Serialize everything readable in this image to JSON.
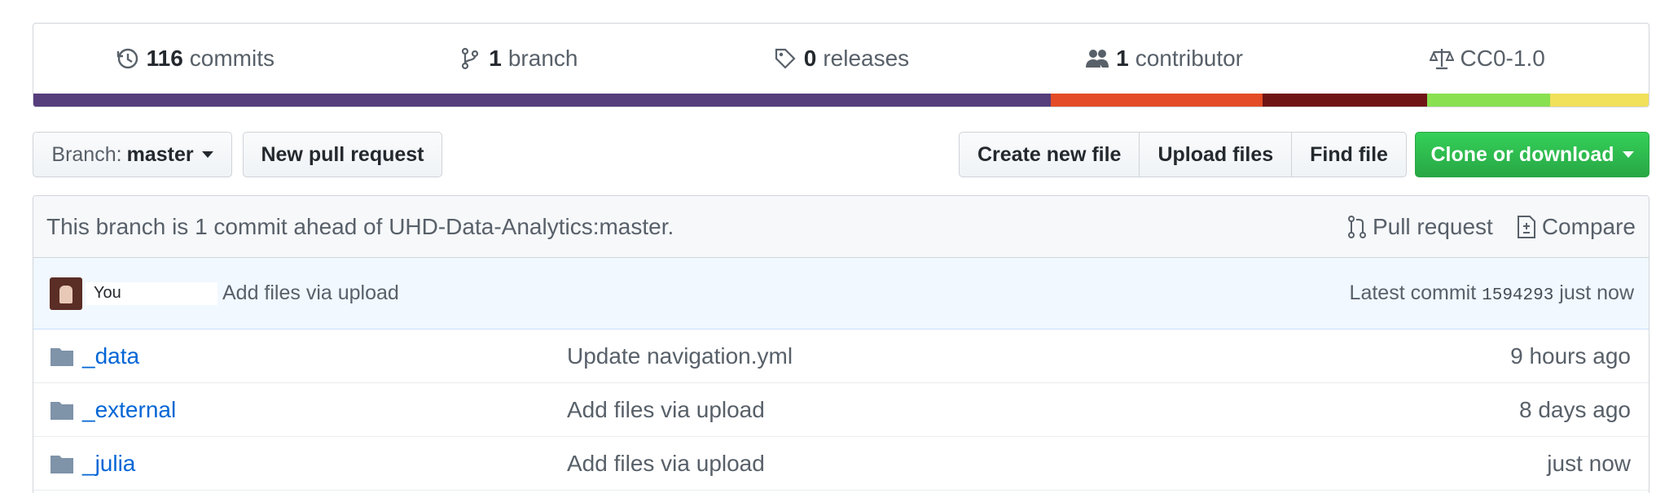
{
  "summary": {
    "commits": {
      "count": "116",
      "label": "commits"
    },
    "branches": {
      "count": "1",
      "label": "branch"
    },
    "releases": {
      "count": "0",
      "label": "releases"
    },
    "contributors": {
      "count": "1",
      "label": "contributor"
    },
    "license": "CC0-1.0"
  },
  "language_bar": [
    {
      "color": "#563d7c",
      "percent": 63.0
    },
    {
      "color": "#e34c26",
      "percent": 13.1
    },
    {
      "color": "#701516",
      "percent": 10.2
    },
    {
      "color": "#89e051",
      "percent": 7.6
    },
    {
      "color": "#f1e05a",
      "percent": 6.1
    }
  ],
  "toolbar": {
    "branch_prefix": "Branch:",
    "branch_name": "master",
    "new_pr": "New pull request",
    "create_file": "Create new file",
    "upload_files": "Upload files",
    "find_file": "Find file",
    "clone": "Clone or download"
  },
  "branch_info": {
    "text": "This branch is 1 commit ahead of UHD-Data-Analytics:master.",
    "pull_request": "Pull request",
    "compare": "Compare"
  },
  "latest_commit": {
    "author": "You",
    "message": "Add files via upload",
    "prefix": "Latest commit",
    "sha": "1594293",
    "time": "just now"
  },
  "files": [
    {
      "name": "_data",
      "message": "Update navigation.yml",
      "age": "9 hours ago"
    },
    {
      "name": "_external",
      "message": "Add files via upload",
      "age": "8 days ago"
    },
    {
      "name": "_julia",
      "message": "Add files via upload",
      "age": "just now"
    }
  ],
  "colors": {
    "link": "#0366d6",
    "clone_green": "#28a745",
    "muted": "#586069"
  }
}
